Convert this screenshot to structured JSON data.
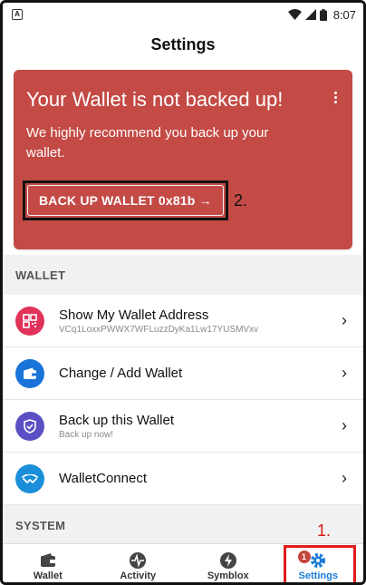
{
  "status_bar": {
    "time": "8:07"
  },
  "header": {
    "title": "Settings"
  },
  "backup_card": {
    "title": "Your Wallet is not backed up!",
    "description": "We highly recommend you back up your wallet.",
    "button_label": "BACK UP WALLET 0x81b →",
    "annotation": "2.",
    "menu_icon": "more-vertical-icon"
  },
  "wallet_section": {
    "header": "WALLET",
    "items": [
      {
        "title": "Show My Wallet Address",
        "subtitle": "VCq1LoxxPWWX7WFLuzzDyKa1Lw17YUSMVxv",
        "icon": "qr-code-icon",
        "color": "#e0335a"
      },
      {
        "title": "Change / Add Wallet",
        "subtitle": "",
        "icon": "wallet-icon",
        "color": "#1a73d9"
      },
      {
        "title": "Back up this Wallet",
        "subtitle": "Back up now!",
        "icon": "shield-icon",
        "color": "#5b4fc4"
      },
      {
        "title": "WalletConnect",
        "subtitle": "",
        "icon": "walletconnect-icon",
        "color": "#1a8ed9"
      }
    ]
  },
  "system_section": {
    "header": "SYSTEM"
  },
  "bottom_nav": {
    "items": [
      {
        "label": "Wallet",
        "icon": "wallet-icon"
      },
      {
        "label": "Activity",
        "icon": "activity-icon"
      },
      {
        "label": "Symblox",
        "icon": "lightning-icon"
      },
      {
        "label": "Settings",
        "icon": "gear-icon",
        "badge": "1"
      }
    ],
    "annotation": "1."
  }
}
